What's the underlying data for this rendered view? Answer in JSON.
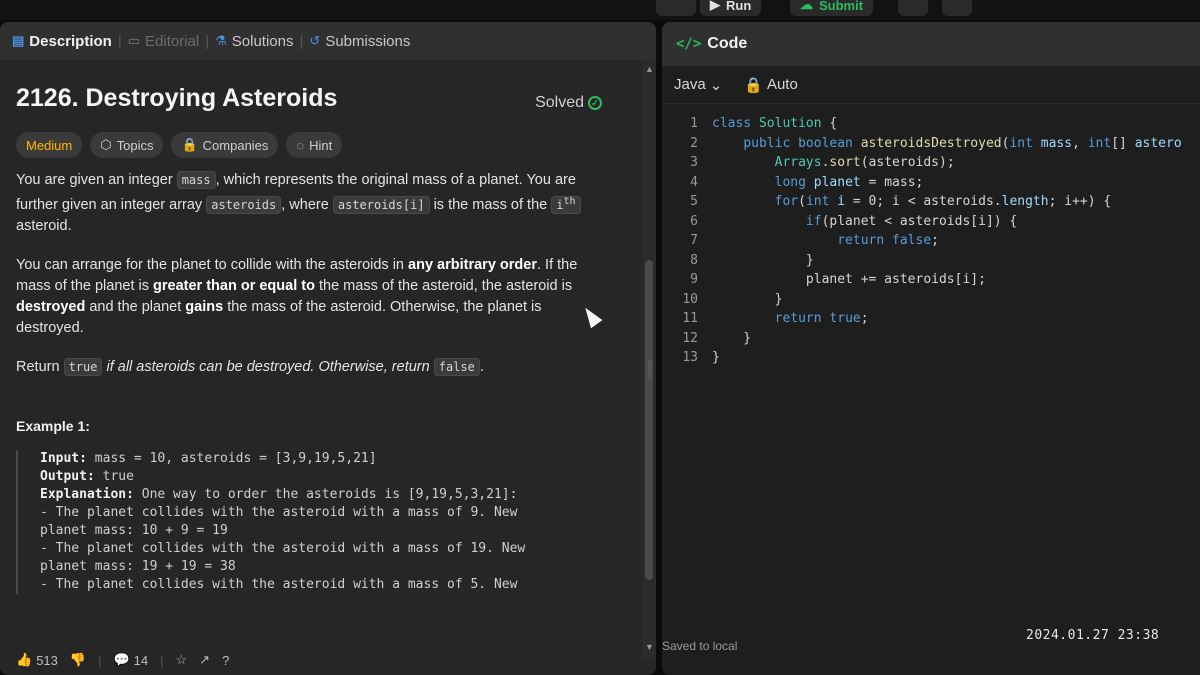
{
  "topbar": {
    "run_label": "Run",
    "submit_label": "Submit"
  },
  "left_tabs": [
    {
      "label": "Description",
      "icon": "description-icon",
      "state": "active"
    },
    {
      "label": "Editorial",
      "icon": "editorial-icon",
      "state": "dim"
    },
    {
      "label": "Solutions",
      "icon": "solutions-icon",
      "state": "normal"
    },
    {
      "label": "Submissions",
      "icon": "submissions-icon",
      "state": "normal"
    }
  ],
  "problem": {
    "title": "2126. Destroying Asteroids",
    "status": "Solved",
    "tags": {
      "difficulty": "Medium",
      "topics": "Topics",
      "companies": "Companies",
      "hint": "Hint"
    },
    "p1": {
      "a": "You are given an integer ",
      "mass": "mass",
      "b": ", which represents the original mass of a planet. You are further given an integer array ",
      "asteroids": "asteroids",
      "c": ", where ",
      "asteroids_i": "asteroids[i]",
      "d": " is the mass of the ",
      "i": "i",
      "th": "th",
      "e": " asteroid."
    },
    "p2": {
      "a": "You can arrange for the planet to collide with the asteroids in ",
      "b": "any arbitrary order",
      "c": ". If the mass of the planet is ",
      "d": "greater than or equal to",
      "e": " the mass of the asteroid, the asteroid is ",
      "f": "destroyed",
      "g": " and the planet ",
      "h": "gains",
      "i": " the mass of the asteroid. Otherwise, the planet is destroyed."
    },
    "p3": {
      "a": "Return ",
      "true": "true",
      "b": " if all asteroids can be destroyed. Otherwise, return ",
      "false": "false",
      "c": "."
    },
    "example_heading": "Example 1:",
    "example": {
      "input_label": "Input:",
      "input": " mass = 10, asteroids = [3,9,19,5,21]",
      "output_label": "Output:",
      "output": " true",
      "explanation_label": "Explanation:",
      "explanation": " One way to order the asteroids is [9,19,5,3,21]:",
      "line1": "- The planet collides with the asteroid with a mass of 9. New",
      "line2": "planet mass: 10 + 9 = 19",
      "line3": "- The planet collides with the asteroid with a mass of 19. New",
      "line4": "planet mass: 19 + 19 = 38",
      "line5": "- The planet collides with the asteroid with a mass of 5. New"
    }
  },
  "footer": {
    "likes": "513",
    "comments": "14"
  },
  "code_panel": {
    "title": "Code",
    "language": "Java",
    "mode": "Auto",
    "saved": "Saved to local",
    "line_numbers": [
      "1",
      "2",
      "3",
      "4",
      "5",
      "6",
      "7",
      "8",
      "9",
      "10",
      "11",
      "12",
      "13"
    ],
    "lines": [
      [
        [
          "kw",
          "class "
        ],
        [
          "cls",
          "Solution "
        ],
        [
          "txt",
          "{"
        ]
      ],
      [
        [
          "txt",
          "    "
        ],
        [
          "kw",
          "public boolean "
        ],
        [
          "fn",
          "asteroidsDestroyed"
        ],
        [
          "txt",
          "("
        ],
        [
          "kw",
          "int "
        ],
        [
          "var",
          "mass"
        ],
        [
          "txt",
          ", "
        ],
        [
          "kw",
          "int"
        ],
        [
          "txt",
          "[] "
        ],
        [
          "var",
          "astero"
        ]
      ],
      [
        [
          "txt",
          "        "
        ],
        [
          "cls",
          "Arrays"
        ],
        [
          "txt",
          "."
        ],
        [
          "fn",
          "sort"
        ],
        [
          "txt",
          "(asteroids);"
        ]
      ],
      [
        [
          "txt",
          "        "
        ],
        [
          "kw",
          "long "
        ],
        [
          "var",
          "planet "
        ],
        [
          "txt",
          "= mass;"
        ]
      ],
      [
        [
          "txt",
          "        "
        ],
        [
          "kw",
          "for"
        ],
        [
          "txt",
          "("
        ],
        [
          "kw",
          "int "
        ],
        [
          "var",
          "i "
        ],
        [
          "txt",
          "= 0; i < asteroids."
        ],
        [
          "var",
          "length"
        ],
        [
          "txt",
          "; i++) {"
        ]
      ],
      [
        [
          "txt",
          "            "
        ],
        [
          "kw",
          "if"
        ],
        [
          "txt",
          "(planet < asteroids[i]) {"
        ]
      ],
      [
        [
          "txt",
          "                "
        ],
        [
          "kw",
          "return false"
        ],
        [
          "txt",
          ";"
        ]
      ],
      [
        [
          "txt",
          "            }"
        ]
      ],
      [
        [
          "txt",
          "            planet += asteroids[i];"
        ]
      ],
      [
        [
          "txt",
          "        }"
        ]
      ],
      [
        [
          "txt",
          "        "
        ],
        [
          "kw",
          "return true"
        ],
        [
          "txt",
          ";"
        ]
      ],
      [
        [
          "txt",
          "    }"
        ]
      ],
      [
        [
          "txt",
          "}"
        ]
      ]
    ]
  },
  "timestamp": "2024.01.27 23:38"
}
